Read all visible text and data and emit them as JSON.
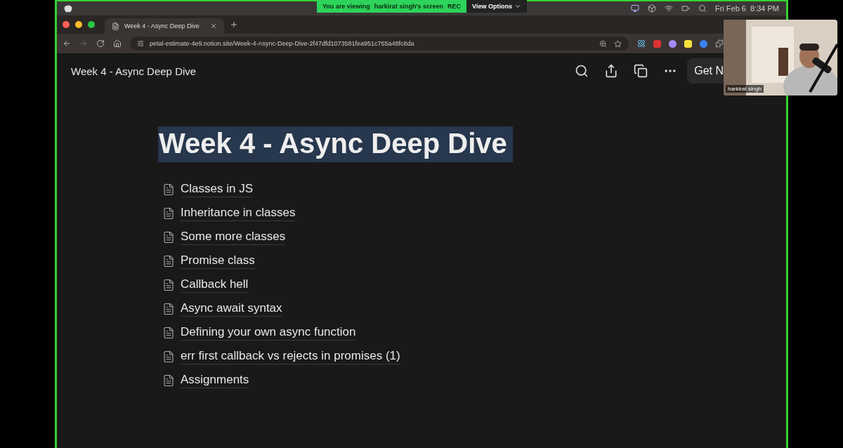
{
  "menu_bar": {
    "banner": {
      "viewing": "You are viewing",
      "presenter": "harkirat singh's screen",
      "rec": "REC",
      "options": "View Options"
    },
    "clock": "Fri Feb 6  8:34 PM"
  },
  "browser": {
    "tabs": [
      {
        "label": "Week 4 - Async Deep Dive",
        "selected": true
      }
    ],
    "url": "petal-estimate-4e9.notion.site/Week-4-Async-Deep-Dive-2f47dfd1073581fea951c765a48fc8da"
  },
  "topbar": {
    "breadcrumb": "Week 4 - Async Deep Dive",
    "button": "Get N"
  },
  "page": {
    "title": "Week 4 - Async Deep Dive",
    "title_highlighted": true,
    "pages": [
      {
        "label": "Classes in JS"
      },
      {
        "label": "Inheritance in classes"
      },
      {
        "label": "Some more classes"
      },
      {
        "label": "Promise class"
      },
      {
        "label": "Callback hell"
      },
      {
        "label": "Async await syntax"
      },
      {
        "label": "Defining your own async function"
      },
      {
        "label": "err first callback vs rejects in promises (1)"
      },
      {
        "label": "Assignments"
      }
    ]
  },
  "video": {
    "name": "harkirat singh",
    "kind": "picture"
  }
}
